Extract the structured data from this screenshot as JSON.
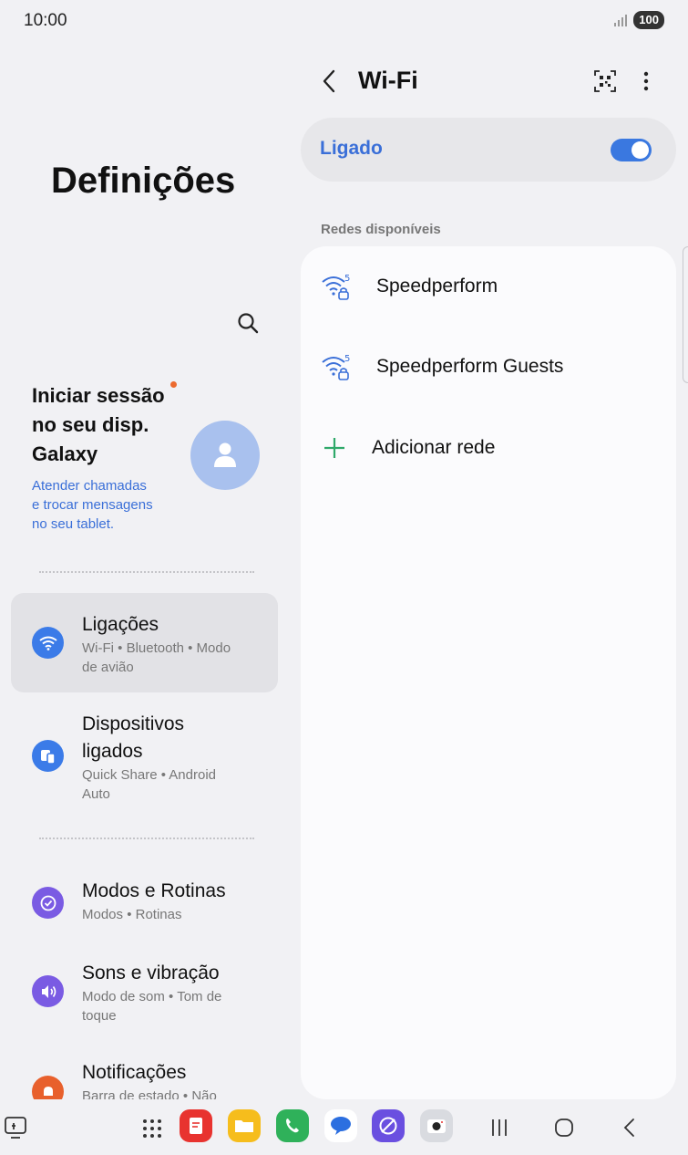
{
  "status_bar": {
    "time": "10:00",
    "battery": "100"
  },
  "left_panel": {
    "title": "Definições",
    "account": {
      "title_line1": "Iniciar sessão",
      "title_line2": "no seu disp.",
      "title_line3": "Galaxy",
      "subtitle_line1": "Atender chamadas",
      "subtitle_line2": "e trocar mensagens",
      "subtitle_line3": "no seu tablet."
    },
    "items": [
      {
        "title": "Ligações",
        "sub1": "Wi-Fi • Bluetooth • Modo",
        "sub2": "de avião",
        "icon": "wifi-icon",
        "color": "#3b7be8"
      },
      {
        "title1": "Dispositivos",
        "title2": "ligados",
        "sub1": "Quick Share • Android",
        "sub2": "Auto",
        "icon": "devices-icon",
        "color": "#3b7be8"
      },
      {
        "title": "Modos e Rotinas",
        "sub1": "Modos • Rotinas",
        "icon": "modes-icon",
        "color": "#7a5be3"
      },
      {
        "title": "Sons e vibração",
        "sub1": "Modo de som • Tom de",
        "sub2": "toque",
        "icon": "volume-icon",
        "color": "#7a5be3"
      },
      {
        "title": "Notificações",
        "sub1": "Barra de estado • Não",
        "icon": "bell-icon",
        "color": "#e8602c"
      }
    ]
  },
  "right_panel": {
    "title": "Wi-Fi",
    "toggle_label": "Ligado",
    "toggle_on": true,
    "section_label": "Redes disponíveis",
    "networks": [
      {
        "name": "Speedperform",
        "icon": "wifi-lock-icon"
      },
      {
        "name": "Speedperform Guests",
        "icon": "wifi-lock-icon"
      }
    ],
    "add_network": "Adicionar rede"
  },
  "colors": {
    "accent": "#3a6fd8",
    "background": "#f1f1f4",
    "card": "#fbfbfd"
  }
}
